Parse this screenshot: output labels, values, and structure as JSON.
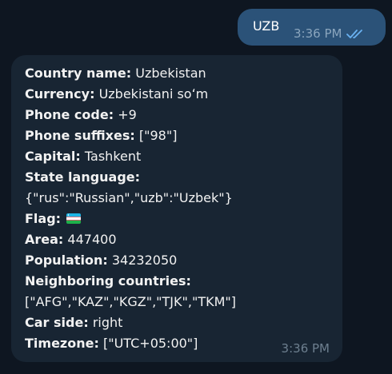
{
  "outgoing": {
    "text": "UZB",
    "time": "3:36 PM",
    "status_icon": "double-check-icon"
  },
  "incoming": {
    "time": "3:36 PM",
    "fields": [
      {
        "label": "Country name:",
        "value": "Uzbekistan"
      },
      {
        "label": "Currency:",
        "value": "Uzbekistani soʻm"
      },
      {
        "label": "Phone code:",
        "value": "+9"
      },
      {
        "label": "Phone suffixes:",
        "value": "[\"98\"]"
      },
      {
        "label": "Capital:",
        "value": "Tashkent"
      },
      {
        "label": "State language:",
        "value": ""
      },
      {
        "label": "",
        "value": "{\"rus\":\"Russian\",\"uzb\":\"Uzbek\"}"
      },
      {
        "label": "Flag:",
        "value": "",
        "icon": "uzbekistan-flag-icon"
      },
      {
        "label": "Area:",
        "value": "447400"
      },
      {
        "label": "Population:",
        "value": "34232050"
      },
      {
        "label": "Neighboring countries:",
        "value": ""
      },
      {
        "label": "",
        "value": "[\"AFG\",\"KAZ\",\"KGZ\",\"TJK\",\"TKM\"]"
      },
      {
        "label": "Car side:",
        "value": "right"
      },
      {
        "label": "Timezone:",
        "value": "[\"UTC+05:00\"]"
      }
    ]
  },
  "colors": {
    "background": "#0e1621",
    "outgoing_bubble": "#2b5278",
    "incoming_bubble": "#182533",
    "check_color": "#6ab2f2"
  }
}
